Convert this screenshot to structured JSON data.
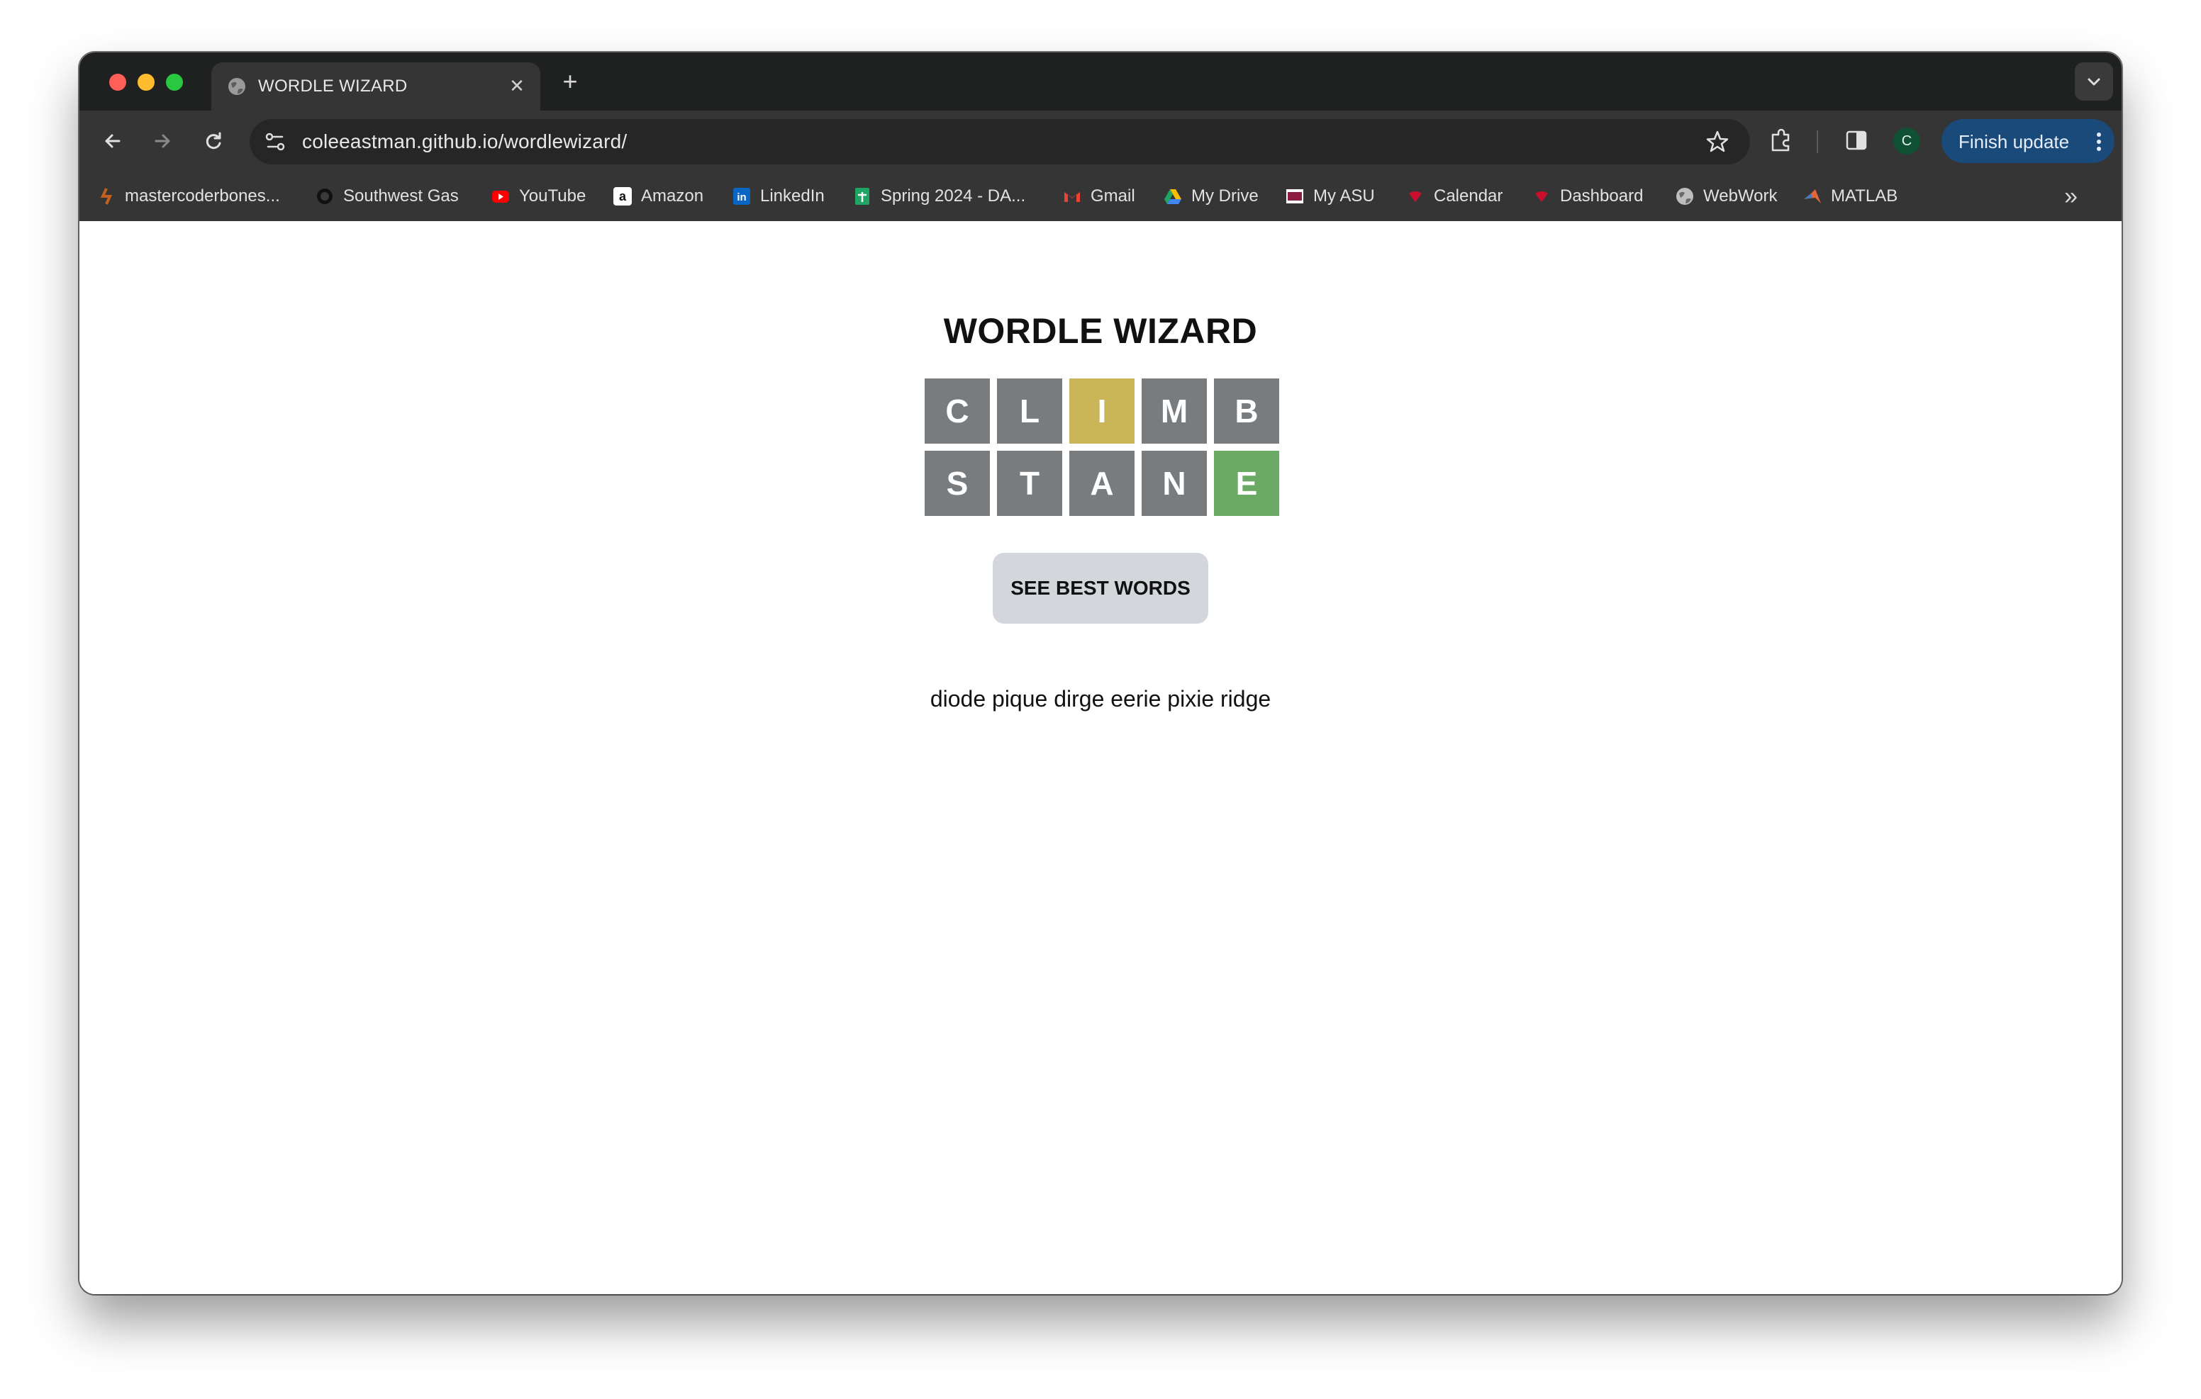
{
  "browser": {
    "tab_title": "WORDLE WIZARD",
    "url": "coleeastman.github.io/wordlewizard/",
    "profile_initial": "C",
    "finish_update_label": "Finish update"
  },
  "bookmarks": [
    {
      "label": "mastercoderbones...",
      "icon": "bones-icon",
      "color": "#c2611f"
    },
    {
      "label": "Southwest Gas",
      "icon": "flame-icon",
      "color": "#111111"
    },
    {
      "label": "YouTube",
      "icon": "youtube-icon",
      "color": "#ff0000"
    },
    {
      "label": "Amazon",
      "icon": "amazon-icon",
      "color": "#ffffff"
    },
    {
      "label": "LinkedIn",
      "icon": "linkedin-icon",
      "color": "#0a66c2"
    },
    {
      "label": "Spring 2024 - DA...",
      "icon": "sheets-icon",
      "color": "#1fa463"
    },
    {
      "label": "Gmail",
      "icon": "gmail-icon",
      "color": "#ea4335"
    },
    {
      "label": "My Drive",
      "icon": "drive-icon",
      "color": "#fbbc04"
    },
    {
      "label": "My ASU",
      "icon": "asu-icon",
      "color": "#8c1d40"
    },
    {
      "label": "Calendar",
      "icon": "calendar-icon",
      "color": "#c8102e"
    },
    {
      "label": "Dashboard",
      "icon": "dashboard-icon",
      "color": "#c8102e"
    },
    {
      "label": "WebWork",
      "icon": "globe-icon",
      "color": "#bdbdbd"
    },
    {
      "label": "MATLAB",
      "icon": "matlab-icon",
      "color": "#e16737"
    }
  ],
  "page": {
    "title": "WORDLE WIZARD",
    "colors": {
      "gray": "#787c7e",
      "yellow": "#c9b458",
      "green": "#6aaa64"
    },
    "rows": [
      [
        {
          "letter": "C",
          "state": "gray"
        },
        {
          "letter": "L",
          "state": "gray"
        },
        {
          "letter": "I",
          "state": "yellow"
        },
        {
          "letter": "M",
          "state": "gray"
        },
        {
          "letter": "B",
          "state": "gray"
        }
      ],
      [
        {
          "letter": "S",
          "state": "gray"
        },
        {
          "letter": "T",
          "state": "gray"
        },
        {
          "letter": "A",
          "state": "gray"
        },
        {
          "letter": "N",
          "state": "gray"
        },
        {
          "letter": "E",
          "state": "green"
        }
      ]
    ],
    "button_label": "SEE BEST WORDS",
    "best_words": "diode pique dirge eerie pixie ridge"
  }
}
